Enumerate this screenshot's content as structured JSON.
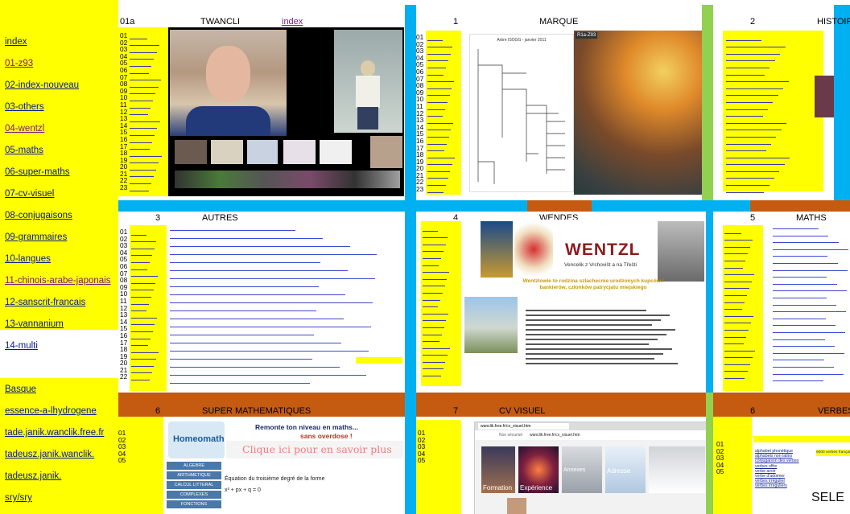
{
  "nav": {
    "links": [
      {
        "label": "index",
        "visited": false
      },
      {
        "label": "01-z93",
        "visited": true
      },
      {
        "label": "02-index-nouveau",
        "visited": false
      },
      {
        "label": "03-others",
        "visited": false
      },
      {
        "label": "04-wentzl",
        "visited": true
      },
      {
        "label": "05-maths",
        "visited": false
      },
      {
        "label": "06-super-maths",
        "visited": false
      },
      {
        "label": "07-cv-visuel",
        "visited": false
      },
      {
        "label": "08-conjugaisons",
        "visited": false
      },
      {
        "label": "09-grammaires",
        "visited": false
      },
      {
        "label": "10-langues",
        "visited": false
      },
      {
        "label": "11-chinois-arabe-japonais",
        "visited": true
      },
      {
        "label": "12-sanscrit-francais",
        "visited": false
      },
      {
        "label": "13-vannanium",
        "visited": false
      },
      {
        "label": "14-multi",
        "visited": false
      }
    ],
    "links2": [
      {
        "label": "Basque"
      },
      {
        "label": "essence-a-lhydrogene"
      },
      {
        "label": "tade.janik.wanclik.free.fr"
      },
      {
        "label": "tadeusz.janik.wanclik."
      },
      {
        "label": "tadeusz.janik."
      },
      {
        "label": "sry/sry"
      }
    ]
  },
  "panels": {
    "p01": {
      "num": "01a",
      "title": "TWANCLI",
      "link": "index"
    },
    "p1": {
      "num": "1",
      "title": "MARQUE"
    },
    "p2": {
      "num": "2",
      "title": "HISTOIRE"
    },
    "p3": {
      "num": "3",
      "title": "AUTRES"
    },
    "p4": {
      "num": "4",
      "title": "WENDES"
    },
    "p5": {
      "num": "5",
      "title": "MATHS"
    },
    "p6": {
      "num": "6",
      "title": "SUPER MATHEMATIQUES"
    },
    "p7": {
      "num": "7",
      "title": "CV VISUEL"
    },
    "p8": {
      "num": "6",
      "title": "VERBES"
    }
  },
  "row_numbers": [
    "01",
    "02",
    "03",
    "04",
    "05",
    "06",
    "07",
    "08",
    "09",
    "10",
    "11",
    "12",
    "13",
    "14",
    "15",
    "16",
    "17",
    "18",
    "19",
    "20",
    "21",
    "22",
    "23"
  ],
  "row_numbers_short": [
    "01",
    "02",
    "03",
    "04",
    "05",
    "06",
    "07",
    "08",
    "09",
    "10",
    "11",
    "12",
    "13",
    "14",
    "15",
    "16",
    "17",
    "18",
    "19",
    "20",
    "21",
    "22"
  ],
  "row_numbers_bottom": [
    "01",
    "02",
    "03",
    "04",
    "05"
  ],
  "marque": {
    "tag": "R1a-Z93",
    "chart_title": "Arbre ISOGG - janvier 2011"
  },
  "wentzl": {
    "title": "WENTZL",
    "subtitle": "Vencelik z Vrchovišt a na Třešti",
    "tagline": "Wentzlowie to rodzina szlachecnie urodzonych kupców i bankierów, członków patrycjatu miejskiego"
  },
  "homeomath": {
    "logo": "Homeomath",
    "headline": "Remonte ton niveau en maths...",
    "headline2": "sans overdose !",
    "cta": "Clique ici pour en savoir plus",
    "menu": [
      "ALGEBRE",
      "ARITHMETIQUE",
      "CALCUL LITTERAL",
      "COMPLEXES",
      "FONCTIONS"
    ],
    "equation_title": "Équation du troisième degré de la forme",
    "equation": "x³ + px + q = 0"
  },
  "cvvisuel": {
    "tab": "wanclik.free.fr/cv_visuel.htm",
    "address": "wanclik.free.fr/cv_visuel.htm",
    "security": "Non sécurisé",
    "tiles": [
      "Formation",
      "Expérience",
      "Annexes",
      "Adresse"
    ]
  },
  "verbes": {
    "items": [
      "alphabet phonétique",
      "alphabets non latins",
      "conjugaison des verbes",
      "verbes offre",
      "verbe avoir",
      "verbe d'adoimer",
      "verbes irrégulier",
      "verbes irreguliers"
    ],
    "badge": "6000 verbes français",
    "sele": "SELE"
  },
  "colors": {
    "yellow": "#ffff00",
    "cyan": "#00b0f0",
    "orange": "#c55a11",
    "green": "#92d050",
    "link": "#0a1a8f"
  }
}
